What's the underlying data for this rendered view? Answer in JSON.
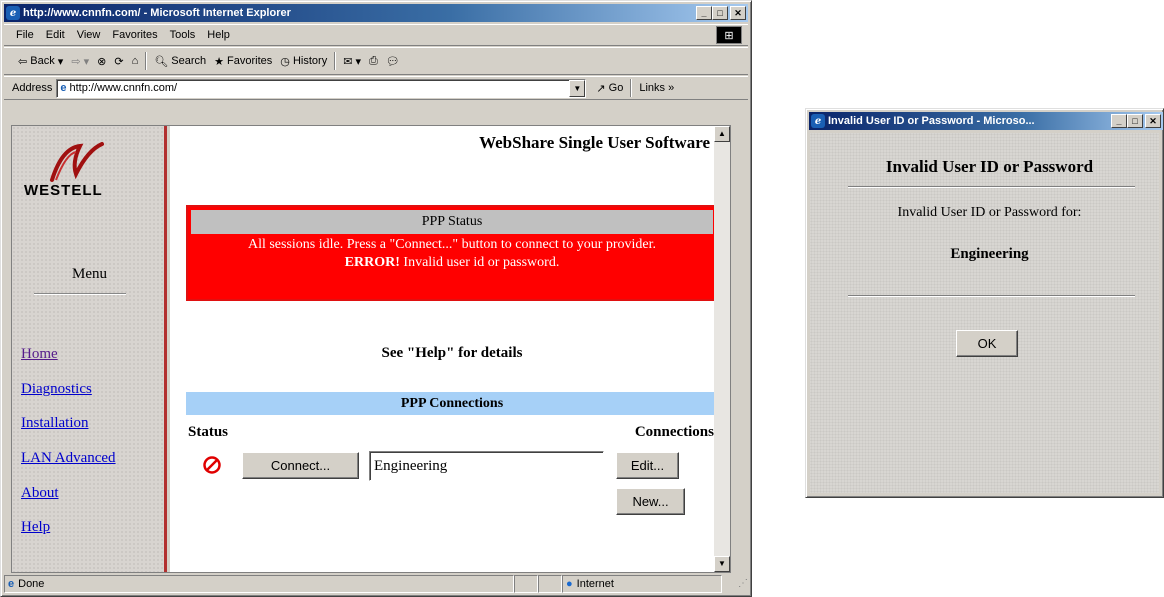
{
  "browser": {
    "title": "http://www.cnnfn.com/ - Microsoft Internet Explorer",
    "menu": [
      "File",
      "Edit",
      "View",
      "Favorites",
      "Tools",
      "Help"
    ],
    "toolbar": {
      "back": "Back",
      "search": "Search",
      "favorites": "Favorites",
      "history": "History"
    },
    "address_label": "Address",
    "address_value": "http://www.cnnfn.com/",
    "go_label": "Go",
    "links_label": "Links",
    "status_text": "Done",
    "zone_text": "Internet"
  },
  "page": {
    "brand": "WESTELL",
    "menu_heading": "Menu",
    "nav": [
      "Home",
      "Diagnostics",
      "Installation",
      "LAN Advanced",
      "About",
      "Help"
    ],
    "header_title": "WebShare Single User Software",
    "ppp_status": {
      "title": "PPP Status",
      "message": "All sessions idle. Press a \"Connect...\" button to connect to your provider.",
      "error_label": "ERROR!",
      "error_text": " Invalid user id or password."
    },
    "help_hint": "See \"Help\" for details",
    "connections": {
      "title": "PPP Connections",
      "status_header": "Status",
      "connections_header": "Connections",
      "connect_button": "Connect...",
      "connection_name": "Engineering",
      "edit_button": "Edit...",
      "new_button": "New..."
    }
  },
  "dialog": {
    "title": "Invalid User ID or Password - Microso...",
    "heading": "Invalid User ID or Password",
    "message": "Invalid User ID or Password for:",
    "user": "Engineering",
    "ok_button": "OK"
  },
  "colors": {
    "error_red": "#ff0000",
    "ppp_header_blue": "#a6d0f7",
    "sidebar_border": "#b23030",
    "titlebar": "#0a246a"
  }
}
